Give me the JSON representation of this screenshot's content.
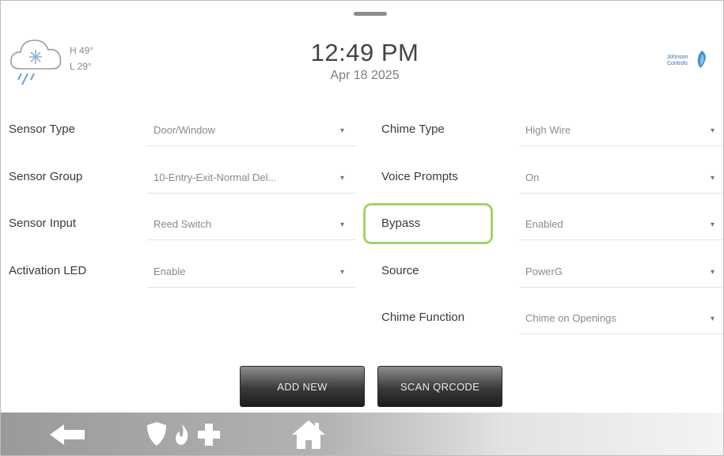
{
  "header": {
    "weather": {
      "icon": "snow-rain-cloud-icon",
      "high": "H 49°",
      "low": "L 29°"
    },
    "time": "12:49 PM",
    "date": "Apr 18 2025",
    "brand": {
      "icon": "johnson-controls-logo-icon",
      "text": "Johnson Controls"
    }
  },
  "left_fields": [
    {
      "label": "Sensor Type",
      "value": "Door/Window"
    },
    {
      "label": "Sensor Group",
      "value": "10-Entry-Exit-Normal Del..."
    },
    {
      "label": "Sensor Input",
      "value": "Reed Switch"
    },
    {
      "label": "Activation LED",
      "value": "Enable"
    }
  ],
  "right_fields": [
    {
      "label": "Chime Type",
      "value": "High Wire"
    },
    {
      "label": "Voice Prompts",
      "value": "On"
    },
    {
      "label": "Bypass",
      "value": "Enabled"
    },
    {
      "label": "Source",
      "value": "PowerG"
    },
    {
      "label": "Chime Function",
      "value": "Chime on Openings"
    }
  ],
  "dropdown_caret": "▾",
  "buttons": {
    "add_new": "ADD NEW",
    "scan_qrcode": "SCAN QRCODE"
  },
  "highlight_color": "#9dd66c",
  "nav": {
    "icons": [
      "back-arrow-icon",
      "shield-icon",
      "fire-icon",
      "medical-cross-icon",
      "home-icon"
    ]
  }
}
